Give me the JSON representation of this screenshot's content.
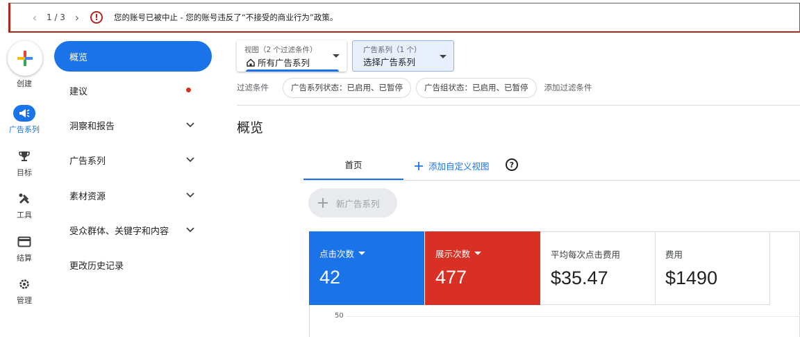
{
  "banner": {
    "pager": "1 / 3",
    "message": "您的账号已被中止 - 您的账号违反了“不接受的商业行为”政策。",
    "alert_color": "#b3261e"
  },
  "rail": {
    "create_label": "创建",
    "items": [
      {
        "label": "广告系列",
        "icon": "campaign-megaphone-icon",
        "active": true
      },
      {
        "label": "目标",
        "icon": "trophy-icon"
      },
      {
        "label": "工具",
        "icon": "tools-icon"
      },
      {
        "label": "结算",
        "icon": "credit-card-icon"
      },
      {
        "label": "管理",
        "icon": "gear-icon"
      }
    ]
  },
  "nav": {
    "items": [
      {
        "label": "概览",
        "active": true
      },
      {
        "label": "建议",
        "dot": true
      },
      {
        "label": "洞察和报告",
        "expandable": true
      },
      {
        "label": "广告系列",
        "expandable": true
      },
      {
        "label": "素材资源",
        "expandable": true
      },
      {
        "label": "受众群体、关键字和内容",
        "expandable": true
      },
      {
        "label": "更改历史记录"
      }
    ]
  },
  "view_selector": {
    "small": "视图（2 个过滤条件）",
    "value": "所有广告系列"
  },
  "campaign_selector": {
    "small": "广告系列（1 个）",
    "value": "选择广告系列"
  },
  "filters": {
    "label": "过滤条件",
    "chips": [
      "广告系列状态：已启用、已暂停",
      "广告组状态：已启用、已暂停"
    ],
    "add": "添加过滤条件"
  },
  "page_title": "概览",
  "tabs": {
    "home": "首页",
    "custom": "添加自定义视图"
  },
  "new_campaign": "新广告系列",
  "metrics": [
    {
      "label": "点击次数",
      "value": "42",
      "color": "#1a73e8"
    },
    {
      "label": "展示次数",
      "value": "477",
      "color": "#d93025"
    },
    {
      "label": "平均每次点击费用",
      "value": "$35.47"
    },
    {
      "label": "费用",
      "value": "$1490"
    }
  ],
  "chart": {
    "ytick_top": "50"
  },
  "colors": {
    "accent": "#1a73e8",
    "alert_dot": "#d93025"
  }
}
